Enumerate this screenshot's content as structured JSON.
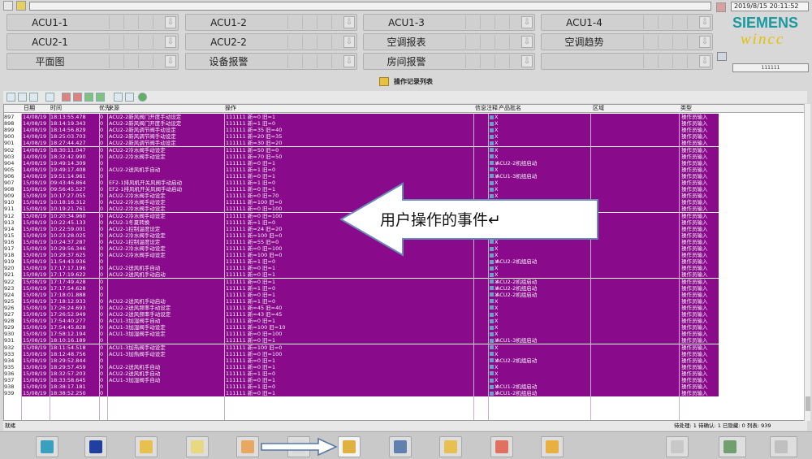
{
  "header": {
    "datetime": "2019/8/15 20:11:52",
    "brand_top": "SIEMENS",
    "brand_bottom": "wincc",
    "user_value": "111111"
  },
  "nav": {
    "buttons": [
      {
        "label": "ACU1-1"
      },
      {
        "label": "ACU1-2"
      },
      {
        "label": "ACU1-3"
      },
      {
        "label": "ACU1-4"
      },
      {
        "label": "ACU2-1"
      },
      {
        "label": "ACU2-2"
      },
      {
        "label": "空调报表"
      },
      {
        "label": "空调趋势"
      },
      {
        "label": "平面图"
      },
      {
        "label": "设备报警"
      },
      {
        "label": "房间报警"
      },
      {
        "label": ""
      }
    ]
  },
  "report": {
    "title": "操作记录列表"
  },
  "table": {
    "columns": {
      "date": "日期",
      "time": "时间",
      "pri": "优先",
      "source": "来源",
      "op": "操作",
      "info": "信息注释",
      "batch": "产品批名",
      "area": "区域",
      "type": "类型"
    },
    "rows": [
      {
        "n": "897",
        "d": "14/08/19",
        "t": "18:13:55.478",
        "p": "0",
        "s": "ACU2-2新风阀门开度手动设定",
        "o": "111111 新=0 旧=1",
        "b": ""
      },
      {
        "n": "898",
        "d": "14/08/19",
        "t": "18:14:19.343",
        "p": "0",
        "s": "ACU2-2新风阀门开度手动设定",
        "o": "111111 新=1 旧=0",
        "b": ""
      },
      {
        "n": "899",
        "d": "14/08/19",
        "t": "18:14:56.829",
        "p": "0",
        "s": "ACU2-2新风调节阀手动设定",
        "o": "111111 新=35 旧=40",
        "b": ""
      },
      {
        "n": "900",
        "d": "14/08/19",
        "t": "18:25:03.703",
        "p": "0",
        "s": "ACU2-2新风调节阀手动设定",
        "o": "111111 新=20 旧=35",
        "b": ""
      },
      {
        "n": "901",
        "d": "14/08/19",
        "t": "18:27:44.427",
        "p": "0",
        "s": "ACU2-2新风调节阀手动设定",
        "o": "111111 新=30 旧=20",
        "b": ""
      },
      {
        "n": "902",
        "d": "14/08/19",
        "t": "18:30:11.047",
        "p": "0",
        "s": "ACU2-2冷水阀手动设定",
        "o": "111111 新=50 旧=0",
        "b": ""
      },
      {
        "n": "903",
        "d": "14/08/19",
        "t": "18:32:42.990",
        "p": "0",
        "s": "ACU2-2冷水阀手动设定",
        "o": "111111 新=70 旧=50",
        "b": ""
      },
      {
        "n": "904",
        "d": "14/08/19",
        "t": "19:49:14.309",
        "p": "0",
        "s": "",
        "o": "111111 新=0 旧=1",
        "b": "ACU2-2机组启动"
      },
      {
        "n": "905",
        "d": "14/08/19",
        "t": "19:49:17.408",
        "p": "0",
        "s": "ACU2-2送风机手自动",
        "o": "111111 新=1 旧=0",
        "b": ""
      },
      {
        "n": "906",
        "d": "14/08/19",
        "t": "19:51:14.961",
        "p": "0",
        "s": "",
        "o": "111111 新=0 旧=1",
        "b": "ACU1-3机组启动"
      },
      {
        "n": "907",
        "d": "15/08/19",
        "t": "09:43:46.864",
        "p": "0",
        "s": "EF2-1排风机开关风阀手动启动",
        "o": "111111 新=1 旧=0",
        "b": ""
      },
      {
        "n": "908",
        "d": "15/08/19",
        "t": "09:56:45.527",
        "p": "0",
        "s": "EF2-1排风机开关风阀手动启动",
        "o": "111111 新=0 旧=1",
        "b": ""
      },
      {
        "n": "909",
        "d": "15/08/19",
        "t": "10:17:27.055",
        "p": "0",
        "s": "ACU2-2冷水阀手动设定",
        "o": "111111 新=0 旧=70",
        "b": ""
      },
      {
        "n": "910",
        "d": "15/08/19",
        "t": "10:18:16.312",
        "p": "0",
        "s": "ACU2-2冷水阀手动设定",
        "o": "111111 新=100 旧=0",
        "b": ""
      },
      {
        "n": "911",
        "d": "15/08/19",
        "t": "10:19:21.761",
        "p": "0",
        "s": "ACU2-2冷水阀手动设定",
        "o": "111111 新=0 旧=100",
        "b": ""
      },
      {
        "n": "912",
        "d": "15/08/19",
        "t": "10:20:34.960",
        "p": "0",
        "s": "ACU2-2冷水阀手动设定",
        "o": "111111 新=0 旧=100",
        "b": ""
      },
      {
        "n": "913",
        "d": "15/08/19",
        "t": "10:22:45.133",
        "p": "0",
        "s": "ACU2-1冬夏转换",
        "o": "111111 新=1 旧=0",
        "b": ""
      },
      {
        "n": "914",
        "d": "15/08/19",
        "t": "10:22:59.001",
        "p": "0",
        "s": "ACU2-1控制温度设定",
        "o": "111111 新=24 旧=20",
        "b": ""
      },
      {
        "n": "915",
        "d": "15/08/19",
        "t": "10:23:28.025",
        "p": "0",
        "s": "ACU2-2冷水阀手动设定",
        "o": "111111 新=100 旧=0",
        "b": ""
      },
      {
        "n": "916",
        "d": "15/08/19",
        "t": "10:24:37.287",
        "p": "0",
        "s": "ACU2-1控制温度设定",
        "o": "111111 新=55 旧=0",
        "b": ""
      },
      {
        "n": "917",
        "d": "15/08/19",
        "t": "10:29:56.346",
        "p": "0",
        "s": "ACU2-2冷水阀手动设定",
        "o": "111111 新=0 旧=100",
        "b": ""
      },
      {
        "n": "918",
        "d": "15/08/19",
        "t": "10:29:37.625",
        "p": "0",
        "s": "ACU2-2冷水阀手动设定",
        "o": "111111 新=100 旧=0",
        "b": ""
      },
      {
        "n": "919",
        "d": "15/08/19",
        "t": "11:54:43.936",
        "p": "0",
        "s": "",
        "o": "111111 新=1 旧=0",
        "b": "ACU2-2机组启动"
      },
      {
        "n": "920",
        "d": "15/08/19",
        "t": "17:17:17.196",
        "p": "0",
        "s": "ACU2-2送风机手自动",
        "o": "111111 新=0 旧=1",
        "b": ""
      },
      {
        "n": "921",
        "d": "15/08/19",
        "t": "17:17:19.622",
        "p": "0",
        "s": "ACU2-2送风机手动启动",
        "o": "111111 新=0 旧=1",
        "b": ""
      },
      {
        "n": "922",
        "d": "15/08/19",
        "t": "17:17:49.428",
        "p": "0",
        "s": "",
        "o": "111111 新=0 旧=1",
        "b": "ACU2-2机组启动"
      },
      {
        "n": "923",
        "d": "15/08/19",
        "t": "17:17:54.628",
        "p": "0",
        "s": "",
        "o": "111111 新=1 旧=0",
        "b": "ACU2-2机组启动"
      },
      {
        "n": "924",
        "d": "15/08/19",
        "t": "17:18:01.888",
        "p": "0",
        "s": "",
        "o": "111111 新=0 旧=1",
        "b": "ACU2-2机组启动"
      },
      {
        "n": "925",
        "d": "15/08/19",
        "t": "17:18:12.933",
        "p": "0",
        "s": "ACU2-2送风机手动启动",
        "o": "111111 新=1 旧=0",
        "b": ""
      },
      {
        "n": "926",
        "d": "15/08/19",
        "t": "17:26:24.693",
        "p": "0",
        "s": "ACU2-2送风频率手动设定",
        "o": "111111 新=45 旧=40",
        "b": ""
      },
      {
        "n": "927",
        "d": "15/08/19",
        "t": "17:26:52.949",
        "p": "0",
        "s": "ACU2-2送风频率手动设定",
        "o": "111111 新=43 旧=45",
        "b": ""
      },
      {
        "n": "928",
        "d": "15/08/19",
        "t": "17:54:40.277",
        "p": "0",
        "s": "ACU1-3加湿阀手自动",
        "o": "111111 新=0 旧=1",
        "b": ""
      },
      {
        "n": "929",
        "d": "15/08/19",
        "t": "17:54:45.828",
        "p": "0",
        "s": "ACU1-3加湿阀手动设定",
        "o": "111111 新=100 旧=10",
        "b": ""
      },
      {
        "n": "930",
        "d": "15/08/19",
        "t": "17:58:12.194",
        "p": "0",
        "s": "ACU1-3加湿阀手动设定",
        "o": "111111 新=0 旧=100",
        "b": ""
      },
      {
        "n": "931",
        "d": "15/08/19",
        "t": "18:10:16.189",
        "p": "0",
        "s": "",
        "o": "111111 新=0 旧=1",
        "b": "ACU1-3机组启动"
      },
      {
        "n": "932",
        "d": "15/08/19",
        "t": "18:11:54.518",
        "p": "0",
        "s": "ACU1-3加热阀手动设定",
        "o": "111111 新=100 旧=0",
        "b": ""
      },
      {
        "n": "933",
        "d": "15/08/19",
        "t": "18:12:48.756",
        "p": "0",
        "s": "ACU1-3加热阀手动设定",
        "o": "111111 新=0 旧=100",
        "b": ""
      },
      {
        "n": "934",
        "d": "15/08/19",
        "t": "18:29:52.844",
        "p": "0",
        "s": "",
        "o": "111111 新=0 旧=1",
        "b": "ACU2-2机组启动"
      },
      {
        "n": "935",
        "d": "15/08/19",
        "t": "18:29:57.459",
        "p": "0",
        "s": "ACU2-2送风机手自动",
        "o": "111111 新=0 旧=1",
        "b": ""
      },
      {
        "n": "936",
        "d": "15/08/19",
        "t": "18:32:57.203",
        "p": "0",
        "s": "ACU2-2送风机手自动",
        "o": "111111 新=1 旧=0",
        "b": ""
      },
      {
        "n": "937",
        "d": "15/08/19",
        "t": "18:33:58.645",
        "p": "0",
        "s": "ACU1-3加湿阀手自动",
        "o": "111111 新=0 旧=1",
        "b": ""
      },
      {
        "n": "938",
        "d": "15/08/19",
        "t": "18:38:17.181",
        "p": "0",
        "s": "",
        "o": "111111 新=1 旧=0",
        "b": "ACU1-2机组启动"
      },
      {
        "n": "939",
        "d": "15/08/19",
        "t": "18:38:52.250",
        "p": "0",
        "s": "",
        "o": "111111 新=0 旧=1",
        "b": "ACU1-2机组启动"
      }
    ],
    "info_mark": "X",
    "type_value": "操作员输入"
  },
  "status": {
    "state": "就绪",
    "counts": "待处理: 1  待确认: 1  已隐藏: 0  列表: 939"
  },
  "callout": {
    "text": "用户操作的事件"
  },
  "colors": {
    "row_purple": "#8a0a8c",
    "brand_teal": "#1a9aa0",
    "brand_yellow": "#e8c000"
  }
}
